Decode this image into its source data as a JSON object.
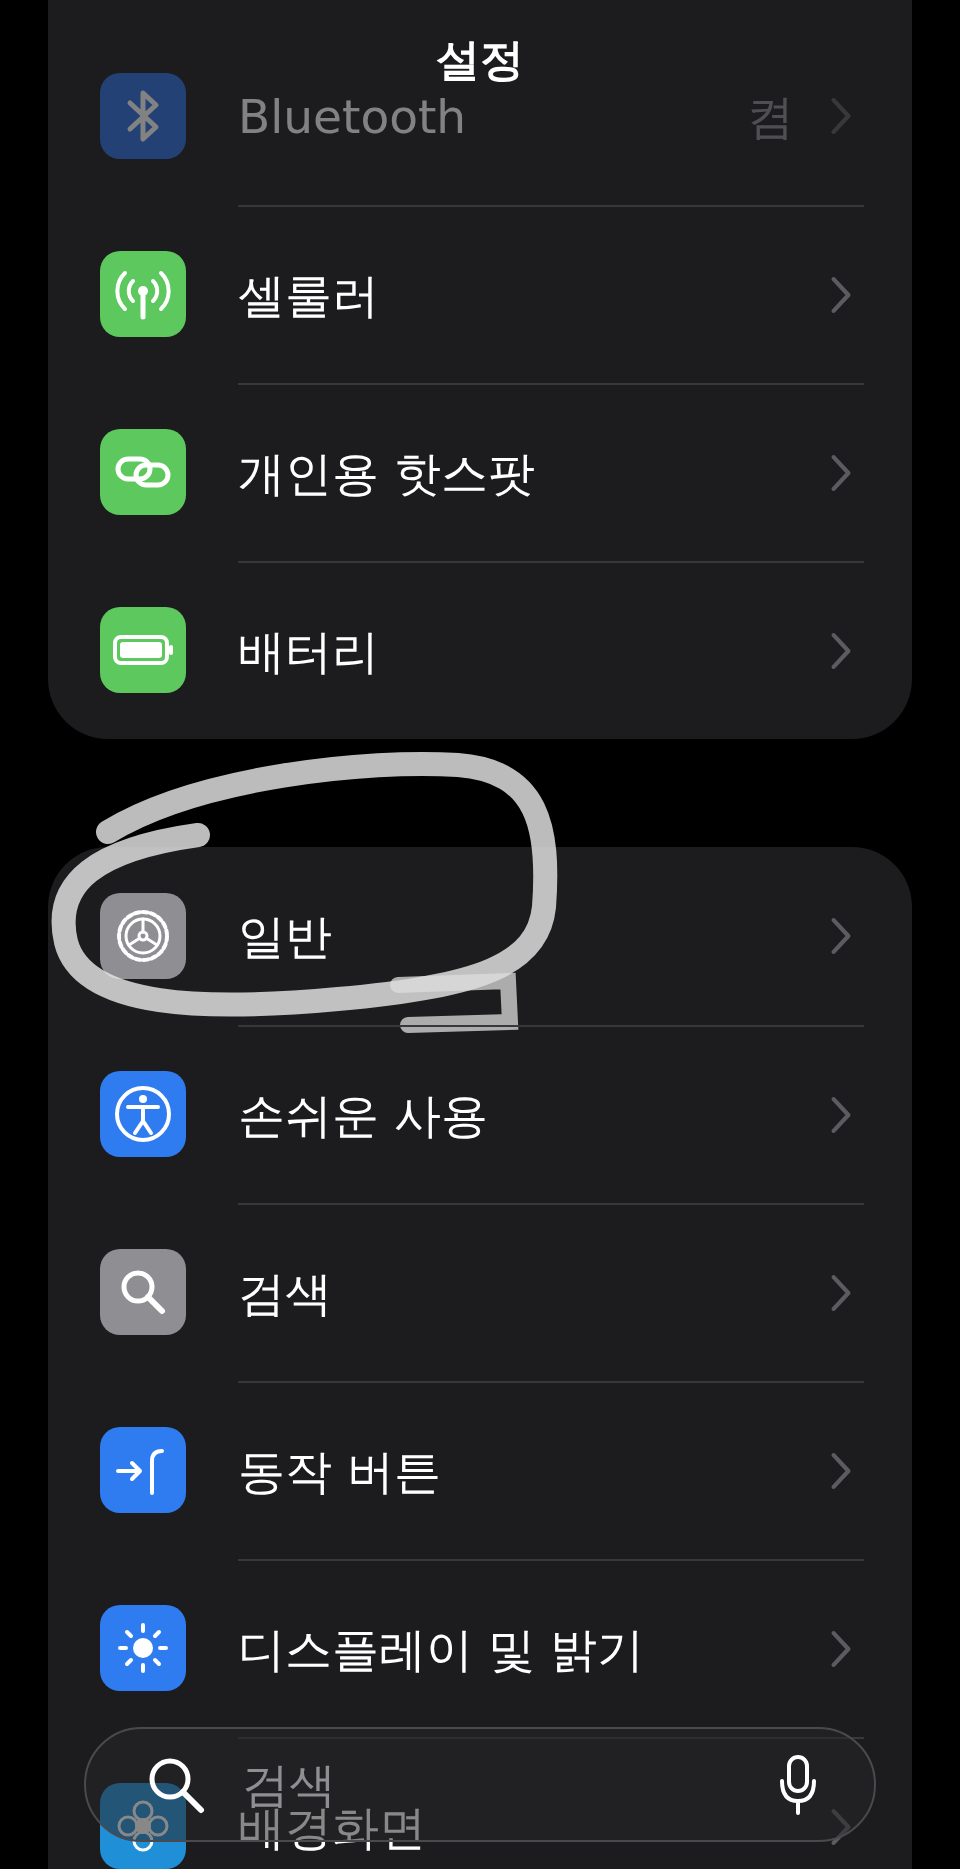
{
  "title": "설정",
  "sections": [
    {
      "items": [
        {
          "label": "Bluetooth",
          "value": "켬",
          "circled": false
        },
        {
          "label": "셀룰러",
          "circled": false
        },
        {
          "label": "개인용 핫스팟",
          "circled": false
        },
        {
          "label": "배터리",
          "circled": false
        }
      ]
    },
    {
      "items": [
        {
          "label": "일반",
          "circled": true
        },
        {
          "label": "손쉬운 사용",
          "circled": false
        },
        {
          "label": "검색",
          "circled": false
        },
        {
          "label": "동작 버튼",
          "circled": false
        },
        {
          "label": "디스플레이 및 밝기",
          "circled": false
        },
        {
          "label": "배경화면",
          "circled": false
        }
      ]
    }
  ],
  "search": {
    "placeholder": "검색"
  }
}
